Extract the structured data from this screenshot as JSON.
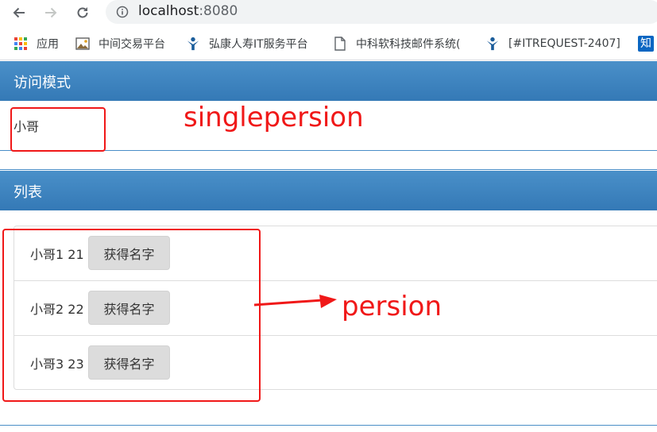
{
  "browser": {
    "url_host": "localhost",
    "url_port": ":8080",
    "bookmarks": [
      {
        "label": "应用",
        "icon": "apps-grid-icon"
      },
      {
        "label": "中间交易平台",
        "icon": "image-icon"
      },
      {
        "label": "弘康人寿IT服务平台",
        "icon": "support-person-icon"
      },
      {
        "label": "中科软科技邮件系统(",
        "icon": "page-icon"
      },
      {
        "label": "[#ITREQUEST-2407]",
        "icon": "support-person-icon"
      },
      {
        "label": "知",
        "icon": "zhihu-icon"
      }
    ]
  },
  "access_panel": {
    "title": "访问模式",
    "value": "小哥"
  },
  "list_panel": {
    "title": "列表",
    "items": [
      {
        "text": "小哥1 21",
        "button": "获得名字"
      },
      {
        "text": "小哥2 22",
        "button": "获得名字"
      },
      {
        "text": "小哥3 23",
        "button": "获得名字"
      }
    ]
  },
  "annotations": {
    "single": "singlepersion",
    "list": "persion",
    "color": "#f01818"
  },
  "colors": {
    "panel_header": "#3b82c0",
    "button_bg": "#dcdcdc"
  }
}
